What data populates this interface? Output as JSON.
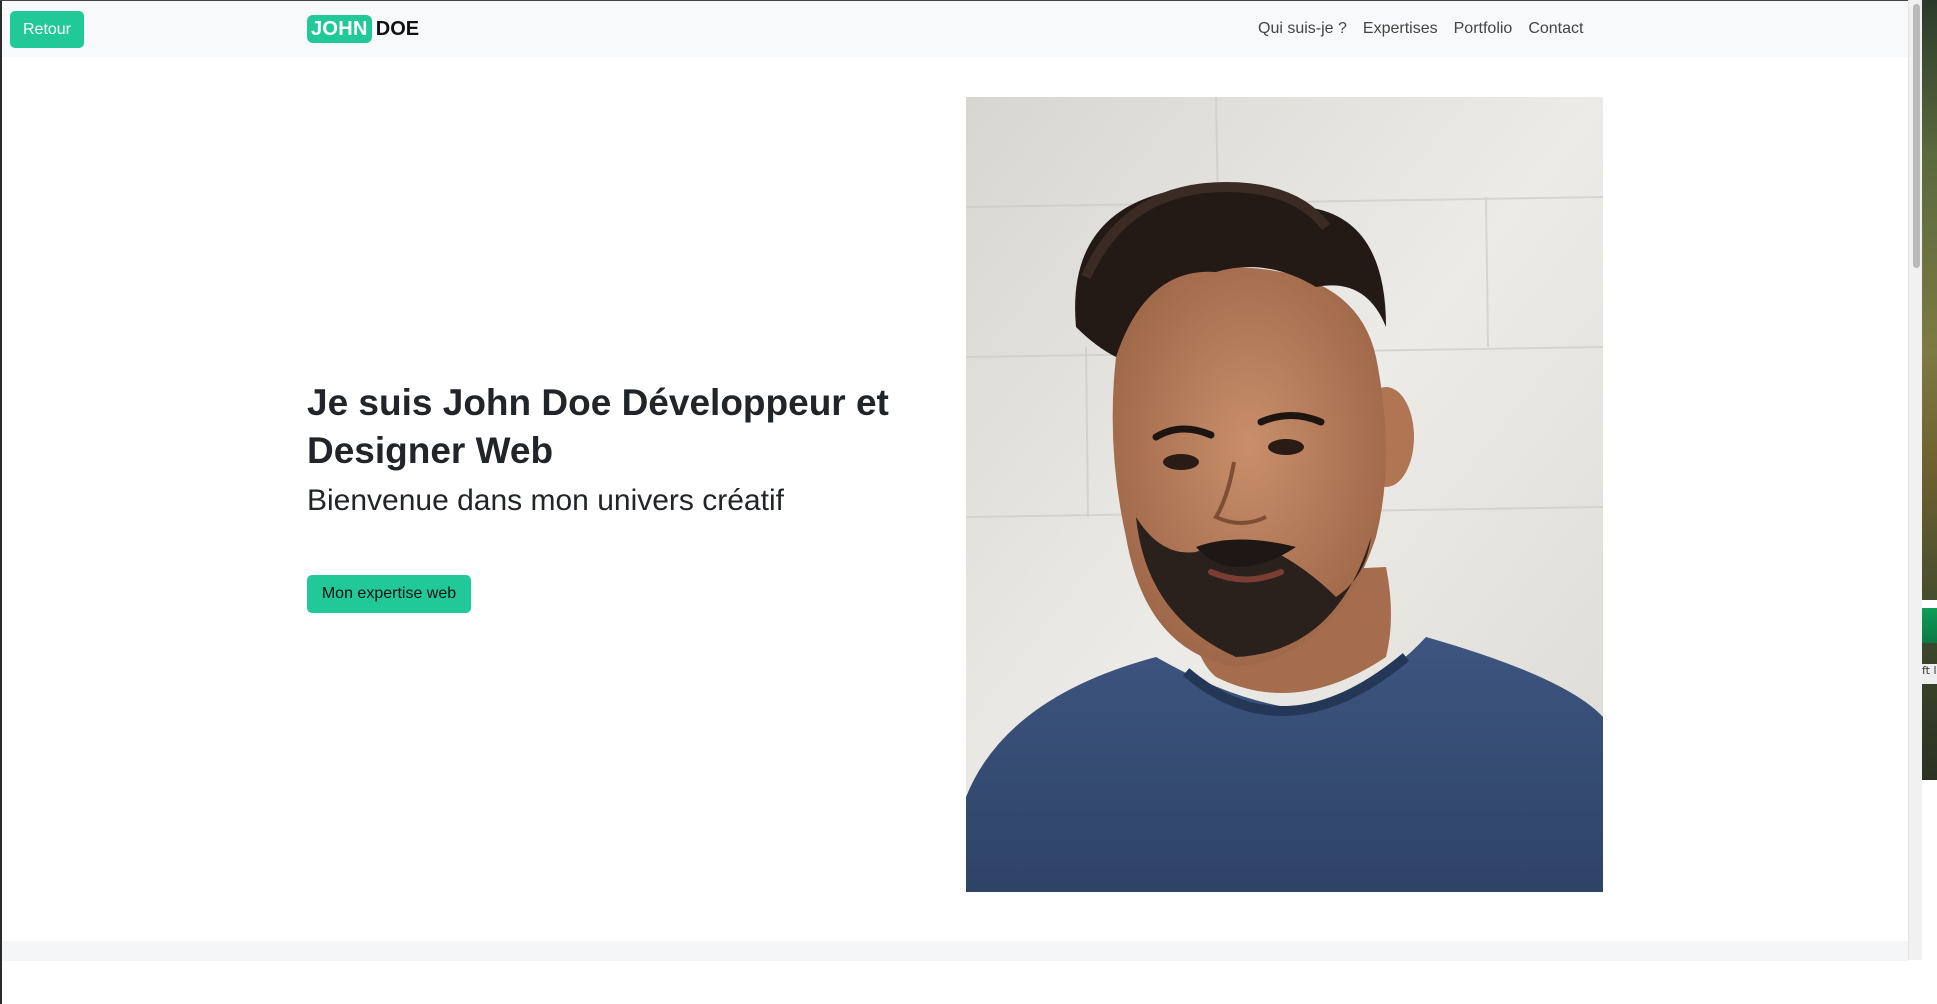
{
  "header": {
    "back_label": "Retour",
    "brand_first": "JOHN",
    "brand_last": "DOE",
    "nav": [
      {
        "label": "Qui suis-je ?"
      },
      {
        "label": "Expertises"
      },
      {
        "label": "Portfolio"
      },
      {
        "label": "Contact"
      }
    ]
  },
  "hero": {
    "title": "Je suis John Doe Développeur et Designer Web",
    "subtitle": "Bienvenue dans mon univers créatif",
    "cta_label": "Mon expertise web"
  },
  "side_peek": {
    "label": "ft l"
  },
  "colors": {
    "accent": "#20c997",
    "navbar_bg": "#f8f9fa",
    "text": "#212529"
  }
}
